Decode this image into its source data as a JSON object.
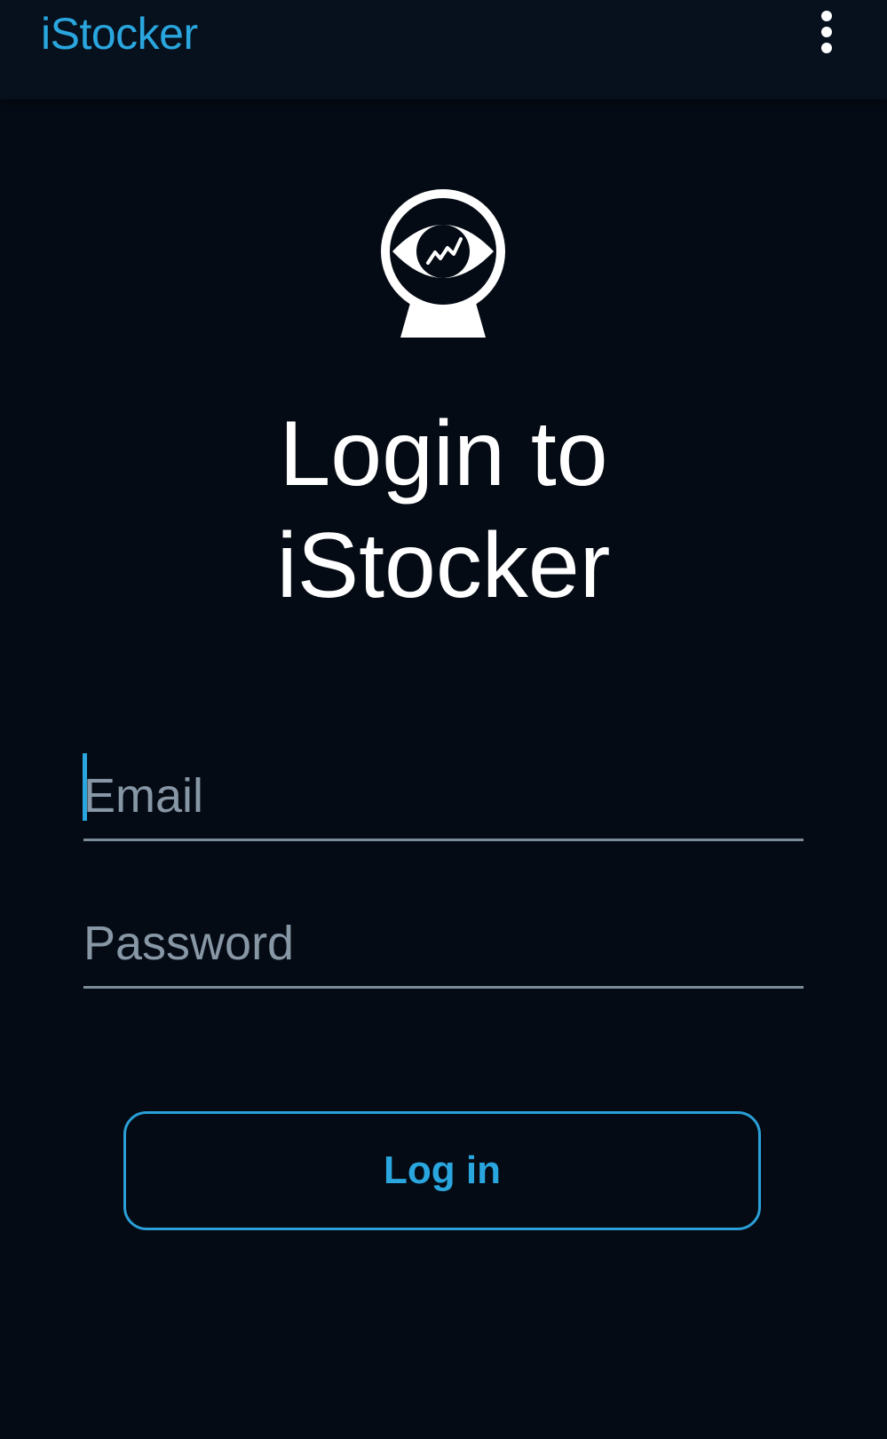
{
  "appbar": {
    "title": "iStocker",
    "menu_icon": "more-vert-icon"
  },
  "logo": {
    "icon": "eye-stock-chart-icon"
  },
  "heading": {
    "line1": "Login to",
    "line2": "iStocker"
  },
  "form": {
    "email_placeholder": "Email",
    "email_value": "",
    "password_placeholder": "Password",
    "password_value": "",
    "login_label": "Log in"
  },
  "colors": {
    "background": "#050b14",
    "appbar": "#07111d",
    "accent": "#2aa6df",
    "text": "#ffffff",
    "hint": "#8797a5"
  }
}
